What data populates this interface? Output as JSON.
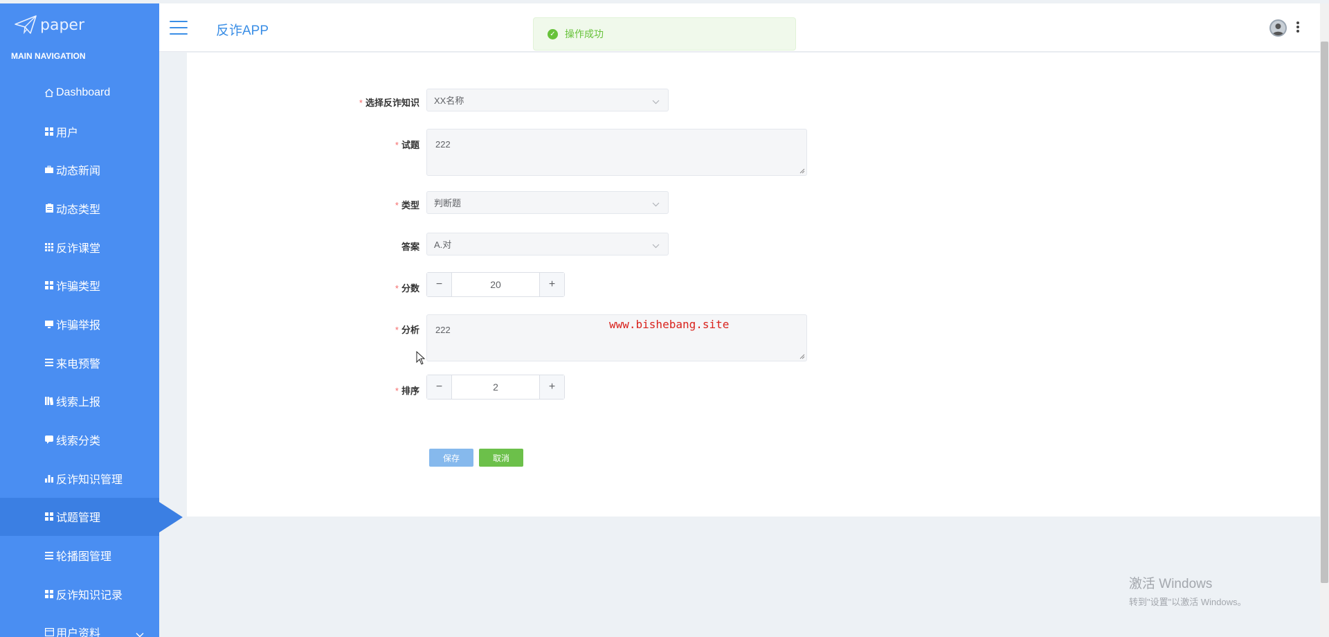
{
  "sidebar": {
    "logo_text": "paper",
    "heading": "MAIN NAVIGATION",
    "items": [
      {
        "label": "Dashboard",
        "icon": "home-icon"
      },
      {
        "label": "用户",
        "icon": "grid-icon"
      },
      {
        "label": "动态新闻",
        "icon": "briefcase-icon"
      },
      {
        "label": "动态类型",
        "icon": "clipboard-icon"
      },
      {
        "label": "反诈课堂",
        "icon": "grid-icon"
      },
      {
        "label": "诈骗类型",
        "icon": "grid-icon"
      },
      {
        "label": "诈骗举报",
        "icon": "monitor-icon"
      },
      {
        "label": "来电预警",
        "icon": "list-icon"
      },
      {
        "label": "线索上报",
        "icon": "book-icon"
      },
      {
        "label": "线索分类",
        "icon": "chat-icon"
      },
      {
        "label": "反诈知识管理",
        "icon": "bar-chart-icon"
      },
      {
        "label": "试题管理",
        "icon": "grid-icon"
      },
      {
        "label": "轮播图管理",
        "icon": "list-icon"
      },
      {
        "label": "反诈知识记录",
        "icon": "grid-icon"
      },
      {
        "label": "用户资料",
        "icon": "card-icon"
      }
    ],
    "active_index": 11
  },
  "header": {
    "app_title": "反诈APP"
  },
  "toast": {
    "message": "操作成功"
  },
  "form": {
    "knowledge": {
      "label": "选择反诈知识",
      "value": "XX名称"
    },
    "question": {
      "label": "试题",
      "value": "222"
    },
    "type": {
      "label": "类型",
      "value": "判断题"
    },
    "answer": {
      "label": "答案",
      "value": "A.对"
    },
    "score": {
      "label": "分数",
      "value": "20"
    },
    "analysis": {
      "label": "分析",
      "value": "222"
    },
    "order": {
      "label": "排序",
      "value": "2"
    },
    "required_mark": "*",
    "save_label": "保存",
    "cancel_label": "取消"
  },
  "watermark": "www.bishebang.site",
  "windows_activation": {
    "line1": "激活 Windows",
    "line2": "转到\"设置\"以激活 Windows。"
  },
  "colors": {
    "sidebar_bg": "#4a8ef2",
    "accent": "#3a8ee6",
    "success": "#67c23a",
    "required": "#f56c6c"
  }
}
